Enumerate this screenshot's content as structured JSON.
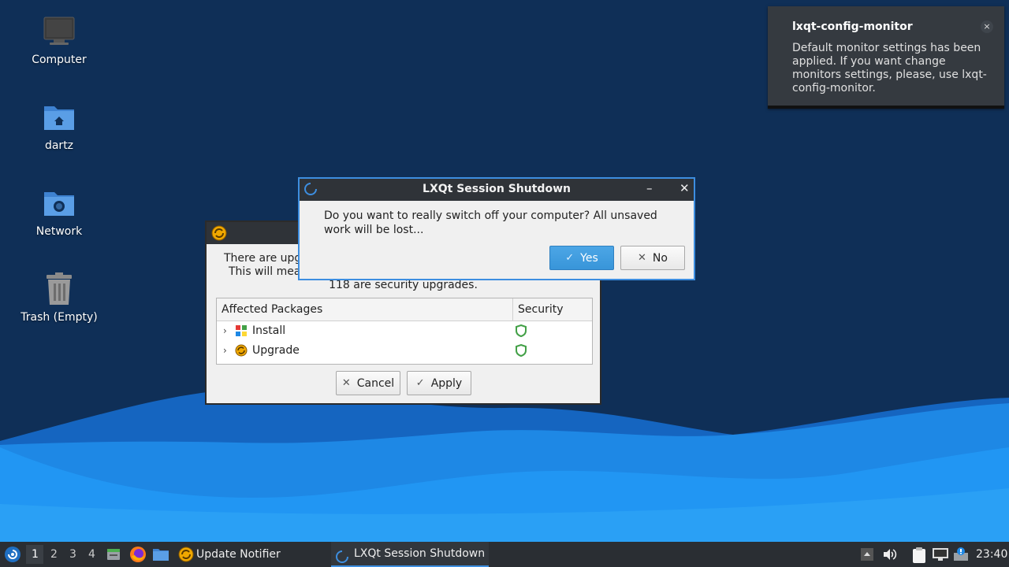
{
  "desktop": {
    "icons": [
      {
        "label": "Computer"
      },
      {
        "label": "dartz"
      },
      {
        "label": "Network"
      },
      {
        "label": "Trash (Empty)"
      }
    ]
  },
  "notification": {
    "title": "lxqt-config-monitor",
    "body": "Default monitor settings has been applied. If you want change monitors settings, please, use lxqt-config-monitor.",
    "close_glyph": "×"
  },
  "updater": {
    "message_line1": "There are upg",
    "message_line2": "This will mea",
    "message_line3": "118 are security upgrades.",
    "table": {
      "col_packages": "Affected Packages",
      "col_security": "Security",
      "rows": [
        {
          "name": "Install"
        },
        {
          "name": "Upgrade"
        }
      ]
    },
    "cancel_label": "Cancel",
    "apply_label": "Apply"
  },
  "shutdown_dialog": {
    "title": "LXQt Session Shutdown",
    "minimize_glyph": "–",
    "close_glyph": "✕",
    "question": "Do you want to really switch off your computer? All unsaved work will be lost...",
    "yes_label": "Yes",
    "no_label": "No"
  },
  "taskbar": {
    "workspaces": [
      "1",
      "2",
      "3",
      "4"
    ],
    "active_workspace": "1",
    "tasks": [
      {
        "label": "Update Notifier"
      },
      {
        "label": "LXQt Session Shutdown"
      }
    ],
    "clock": "23:40"
  },
  "colors": {
    "accent": "#3d8ee0",
    "desktop_bg": "#0f2f57",
    "wave_light": "#1e90ff",
    "panel_bg": "#2a2e33"
  }
}
